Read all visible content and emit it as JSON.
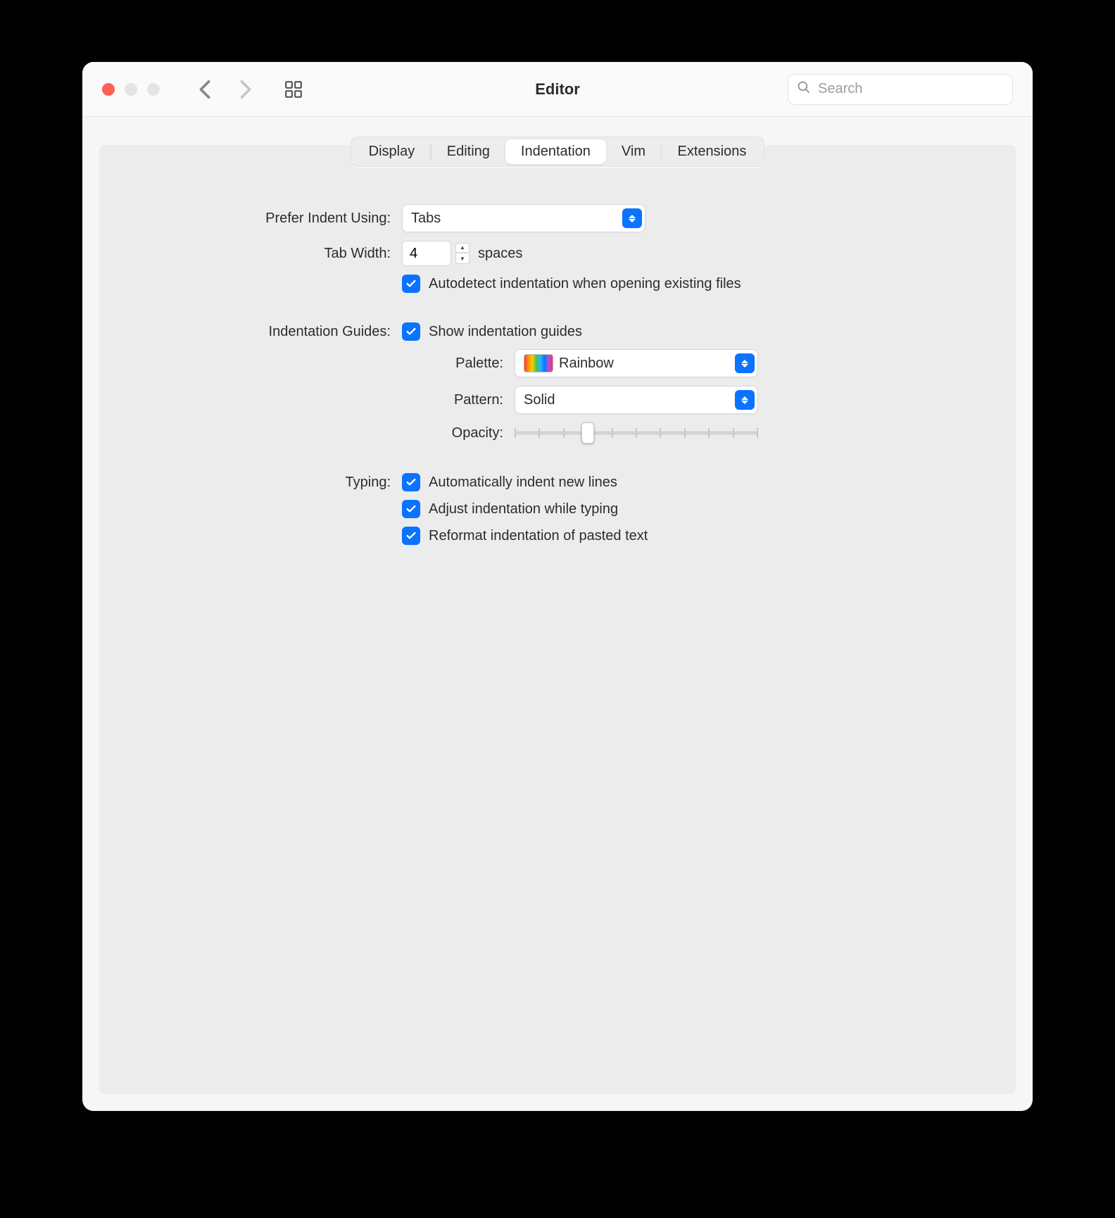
{
  "window": {
    "title": "Editor",
    "search_placeholder": "Search"
  },
  "tabs": {
    "display": "Display",
    "editing": "Editing",
    "indentation": "Indentation",
    "vim": "Vim",
    "extensions": "Extensions"
  },
  "form": {
    "prefer_indent_label": "Prefer Indent Using:",
    "prefer_indent_value": "Tabs",
    "tab_width_label": "Tab Width:",
    "tab_width_value": "4",
    "tab_width_unit": "spaces",
    "autodetect_label": "Autodetect indentation when opening existing files",
    "guides_label": "Indentation Guides:",
    "show_guides_label": "Show indentation guides",
    "palette_label": "Palette:",
    "palette_value": "Rainbow",
    "pattern_label": "Pattern:",
    "pattern_value": "Solid",
    "opacity_label": "Opacity:",
    "typing_label": "Typing:",
    "auto_indent_label": "Automatically indent new lines",
    "adjust_while_typing_label": "Adjust indentation while typing",
    "reformat_pasted_label": "Reformat indentation of pasted text"
  },
  "slider": {
    "ticks": 11,
    "value_index": 3
  }
}
